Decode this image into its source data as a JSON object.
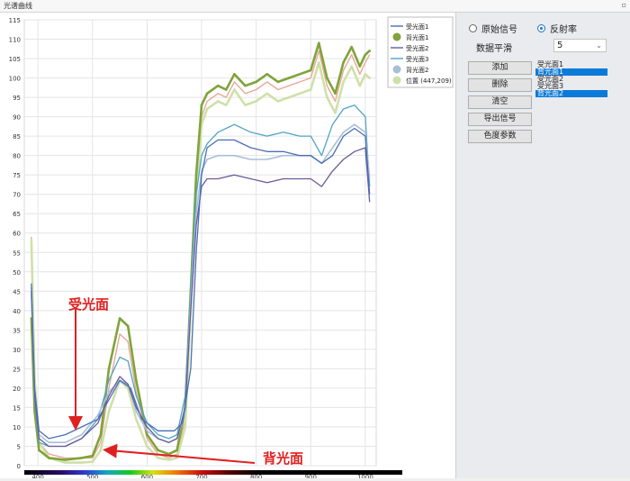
{
  "window": {
    "title": "光谱曲线",
    "pin_icon": "pin-icon"
  },
  "controls": {
    "radio_original": "原始信号",
    "radio_reflectance": "反射率",
    "selected_mode": "反射率",
    "smooth_label": "数据平滑",
    "smooth_value": "5",
    "buttons": {
      "add": "添加",
      "delete": "删除",
      "clear": "清空",
      "export": "导出信号",
      "color_params": "色度参数"
    },
    "list_items": [
      {
        "label": "受光面1",
        "selected": false
      },
      {
        "label": "背光面1",
        "selected": true
      },
      {
        "label": "受光面2",
        "selected": false
      },
      {
        "label": "受光面3",
        "selected": false
      },
      {
        "label": "背光面2",
        "selected": true
      }
    ]
  },
  "annotations": {
    "sunlit": "受光面",
    "shaded": "背光面"
  },
  "legend": {
    "entries": [
      "受光面1",
      "背光面1",
      "受光面2",
      "受光面3",
      "背光面2"
    ],
    "position_entry": "位置 (447,209)"
  },
  "chart_data": {
    "type": "line",
    "xlim": [
      375,
      1020
    ],
    "ylim": [
      0,
      115
    ],
    "x_ticks": [
      400,
      500,
      600,
      700,
      800,
      900,
      1000
    ],
    "y_ticks": [
      0,
      5,
      10,
      15,
      20,
      25,
      30,
      35,
      40,
      45,
      50,
      55,
      60,
      65,
      70,
      75,
      80,
      85,
      90,
      95,
      100,
      105,
      110,
      115
    ],
    "grid": true,
    "legend_position": "top-right",
    "colors": {
      "s1": "#4a6fb5",
      "b1": "#7fa33a",
      "s2": "#6a5a9c",
      "s3": "#4fa3c7",
      "b2": "#a8bfd8",
      "pos": "#cfe0a8",
      "spectrum_bar": "#000000"
    },
    "series": [
      {
        "name": "受光面1",
        "color": "#4a6fb5",
        "points": [
          [
            388,
            47
          ],
          [
            394,
            20
          ],
          [
            402,
            9
          ],
          [
            420,
            7
          ],
          [
            450,
            8
          ],
          [
            480,
            10
          ],
          [
            510,
            12
          ],
          [
            530,
            17
          ],
          [
            550,
            22
          ],
          [
            570,
            20
          ],
          [
            590,
            12
          ],
          [
            620,
            9
          ],
          [
            650,
            9
          ],
          [
            665,
            11
          ],
          [
            680,
            25
          ],
          [
            690,
            55
          ],
          [
            700,
            75
          ],
          [
            710,
            82
          ],
          [
            730,
            84
          ],
          [
            760,
            84
          ],
          [
            790,
            82
          ],
          [
            820,
            81
          ],
          [
            850,
            81
          ],
          [
            880,
            80
          ],
          [
            900,
            80
          ],
          [
            920,
            78
          ],
          [
            940,
            80
          ],
          [
            960,
            85
          ],
          [
            980,
            87
          ],
          [
            1000,
            85
          ],
          [
            1008,
            70
          ]
        ]
      },
      {
        "name": "背光面1",
        "color": "#7fa33a",
        "points": [
          [
            388,
            38
          ],
          [
            394,
            14
          ],
          [
            402,
            4
          ],
          [
            420,
            2
          ],
          [
            450,
            1.5
          ],
          [
            480,
            2
          ],
          [
            500,
            2.5
          ],
          [
            515,
            8
          ],
          [
            530,
            25
          ],
          [
            550,
            38
          ],
          [
            565,
            36
          ],
          [
            580,
            22
          ],
          [
            600,
            8
          ],
          [
            620,
            4
          ],
          [
            640,
            3
          ],
          [
            655,
            4
          ],
          [
            670,
            15
          ],
          [
            680,
            45
          ],
          [
            690,
            75
          ],
          [
            700,
            93
          ],
          [
            710,
            96
          ],
          [
            730,
            98
          ],
          [
            745,
            97
          ],
          [
            760,
            101
          ],
          [
            780,
            98
          ],
          [
            800,
            99
          ],
          [
            820,
            101
          ],
          [
            840,
            99
          ],
          [
            860,
            100
          ],
          [
            880,
            101
          ],
          [
            900,
            102
          ],
          [
            915,
            109
          ],
          [
            930,
            100
          ],
          [
            945,
            96
          ],
          [
            960,
            104
          ],
          [
            975,
            108
          ],
          [
            990,
            103
          ],
          [
            1000,
            106
          ],
          [
            1008,
            107
          ]
        ]
      },
      {
        "name": "受光面2",
        "color": "#6a5a9c",
        "points": [
          [
            388,
            45
          ],
          [
            394,
            18
          ],
          [
            402,
            7
          ],
          [
            420,
            5
          ],
          [
            450,
            5
          ],
          [
            480,
            7
          ],
          [
            510,
            11
          ],
          [
            530,
            18
          ],
          [
            550,
            23
          ],
          [
            565,
            21
          ],
          [
            580,
            15
          ],
          [
            600,
            10
          ],
          [
            620,
            7
          ],
          [
            640,
            6
          ],
          [
            655,
            7
          ],
          [
            670,
            15
          ],
          [
            680,
            40
          ],
          [
            690,
            62
          ],
          [
            700,
            72
          ],
          [
            710,
            74
          ],
          [
            730,
            74
          ],
          [
            760,
            75
          ],
          [
            790,
            74
          ],
          [
            820,
            73
          ],
          [
            850,
            74
          ],
          [
            880,
            74
          ],
          [
            900,
            74
          ],
          [
            920,
            72
          ],
          [
            940,
            76
          ],
          [
            960,
            79
          ],
          [
            980,
            81
          ],
          [
            1000,
            82
          ],
          [
            1008,
            68
          ]
        ]
      },
      {
        "name": "受光面3",
        "color": "#4fa3c7",
        "points": [
          [
            388,
            44
          ],
          [
            394,
            17
          ],
          [
            402,
            6
          ],
          [
            420,
            5
          ],
          [
            450,
            5
          ],
          [
            480,
            7
          ],
          [
            510,
            12
          ],
          [
            530,
            22
          ],
          [
            550,
            28
          ],
          [
            565,
            27
          ],
          [
            580,
            18
          ],
          [
            600,
            11
          ],
          [
            620,
            8
          ],
          [
            640,
            7
          ],
          [
            655,
            8
          ],
          [
            670,
            18
          ],
          [
            680,
            45
          ],
          [
            690,
            70
          ],
          [
            700,
            80
          ],
          [
            710,
            83
          ],
          [
            730,
            86
          ],
          [
            760,
            88
          ],
          [
            790,
            86
          ],
          [
            820,
            85
          ],
          [
            850,
            86
          ],
          [
            880,
            85
          ],
          [
            900,
            85
          ],
          [
            920,
            80
          ],
          [
            940,
            88
          ],
          [
            960,
            92
          ],
          [
            980,
            93
          ],
          [
            1000,
            90
          ],
          [
            1008,
            72
          ]
        ]
      },
      {
        "name": "背光面2",
        "color": "#a8bfd8",
        "points": [
          [
            388,
            46
          ],
          [
            394,
            18
          ],
          [
            402,
            8
          ],
          [
            420,
            6
          ],
          [
            450,
            6
          ],
          [
            480,
            8
          ],
          [
            510,
            13
          ],
          [
            530,
            19
          ],
          [
            550,
            22
          ],
          [
            565,
            21
          ],
          [
            580,
            14
          ],
          [
            600,
            9
          ],
          [
            620,
            7
          ],
          [
            640,
            6
          ],
          [
            655,
            7
          ],
          [
            670,
            14
          ],
          [
            680,
            42
          ],
          [
            690,
            65
          ],
          [
            700,
            76
          ],
          [
            710,
            79
          ],
          [
            730,
            80
          ],
          [
            760,
            80
          ],
          [
            790,
            79
          ],
          [
            820,
            79
          ],
          [
            850,
            80
          ],
          [
            880,
            80
          ],
          [
            900,
            80
          ],
          [
            920,
            78
          ],
          [
            940,
            82
          ],
          [
            960,
            86
          ],
          [
            980,
            88
          ],
          [
            1000,
            86
          ],
          [
            1008,
            74
          ]
        ]
      },
      {
        "name": "位置 (447,209)",
        "color": "#cfe0a8",
        "points": [
          [
            388,
            58
          ],
          [
            394,
            22
          ],
          [
            402,
            6
          ],
          [
            420,
            2
          ],
          [
            450,
            0.8
          ],
          [
            480,
            0.8
          ],
          [
            500,
            1
          ],
          [
            515,
            4
          ],
          [
            530,
            14
          ],
          [
            550,
            22
          ],
          [
            565,
            20
          ],
          [
            580,
            12
          ],
          [
            600,
            5
          ],
          [
            620,
            2
          ],
          [
            640,
            1.5
          ],
          [
            655,
            2
          ],
          [
            670,
            10
          ],
          [
            680,
            40
          ],
          [
            690,
            70
          ],
          [
            700,
            88
          ],
          [
            710,
            92
          ],
          [
            730,
            94
          ],
          [
            745,
            93
          ],
          [
            760,
            97
          ],
          [
            780,
            93
          ],
          [
            800,
            94
          ],
          [
            820,
            96
          ],
          [
            840,
            94
          ],
          [
            860,
            95
          ],
          [
            880,
            96
          ],
          [
            900,
            97
          ],
          [
            915,
            104
          ],
          [
            930,
            95
          ],
          [
            945,
            91
          ],
          [
            960,
            99
          ],
          [
            975,
            103
          ],
          [
            990,
            98
          ],
          [
            1000,
            101
          ],
          [
            1008,
            100
          ]
        ]
      },
      {
        "name": "",
        "color": "#e8a898",
        "points": [
          [
            388,
            59
          ],
          [
            394,
            24
          ],
          [
            402,
            6
          ],
          [
            420,
            3
          ],
          [
            450,
            2
          ],
          [
            480,
            2
          ],
          [
            500,
            2
          ],
          [
            515,
            6
          ],
          [
            530,
            20
          ],
          [
            550,
            34
          ],
          [
            565,
            32
          ],
          [
            580,
            19
          ],
          [
            600,
            7
          ],
          [
            620,
            3
          ],
          [
            640,
            2
          ],
          [
            655,
            3
          ],
          [
            670,
            12
          ],
          [
            680,
            42
          ],
          [
            690,
            72
          ],
          [
            700,
            90
          ],
          [
            710,
            94
          ],
          [
            730,
            96
          ],
          [
            745,
            95
          ],
          [
            760,
            99
          ],
          [
            780,
            96
          ],
          [
            800,
            97
          ],
          [
            820,
            99
          ],
          [
            840,
            97
          ],
          [
            860,
            98
          ],
          [
            880,
            99
          ],
          [
            900,
            100
          ],
          [
            915,
            107
          ],
          [
            930,
            98
          ],
          [
            945,
            94
          ],
          [
            960,
            102
          ],
          [
            975,
            106
          ],
          [
            990,
            101
          ],
          [
            1000,
            104
          ],
          [
            1008,
            106
          ]
        ]
      }
    ]
  }
}
